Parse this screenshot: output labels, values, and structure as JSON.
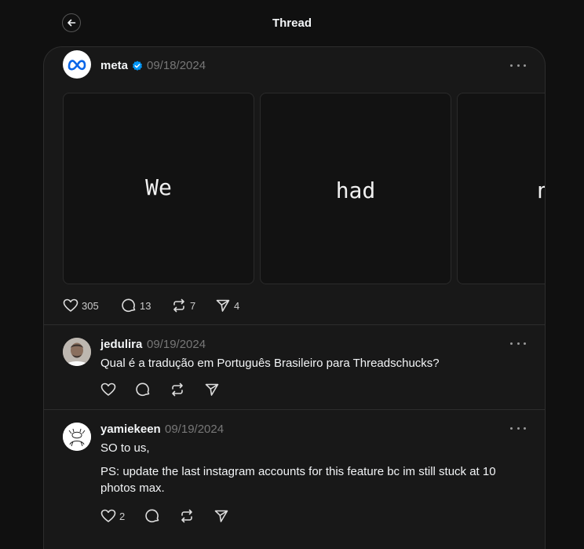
{
  "header": {
    "title": "Thread",
    "back_icon": "arrow-left-icon"
  },
  "post": {
    "username": "meta",
    "verified_icon": "verified-badge-icon",
    "date": "09/18/2024",
    "slides": [
      "We",
      "had",
      "n"
    ],
    "stats": {
      "likes": "305",
      "replies": "13",
      "reposts": "7",
      "shares": "4"
    }
  },
  "replies": [
    {
      "username": "jedulira",
      "date": "09/19/2024",
      "text": "Qual é a tradução em Português Brasileiro para Threadschucks?",
      "likes": "",
      "replies": "",
      "reposts": "",
      "shares": ""
    },
    {
      "username": "yamiekeen",
      "date": "09/19/2024",
      "text_line1": "SO to us,",
      "text_line2": "PS: update the last instagram accounts for this feature bc im still stuck at 10 photos max.",
      "likes": "2"
    }
  ],
  "colors": {
    "background": "#101010",
    "panel": "#181818",
    "verified": "#0095f6"
  }
}
